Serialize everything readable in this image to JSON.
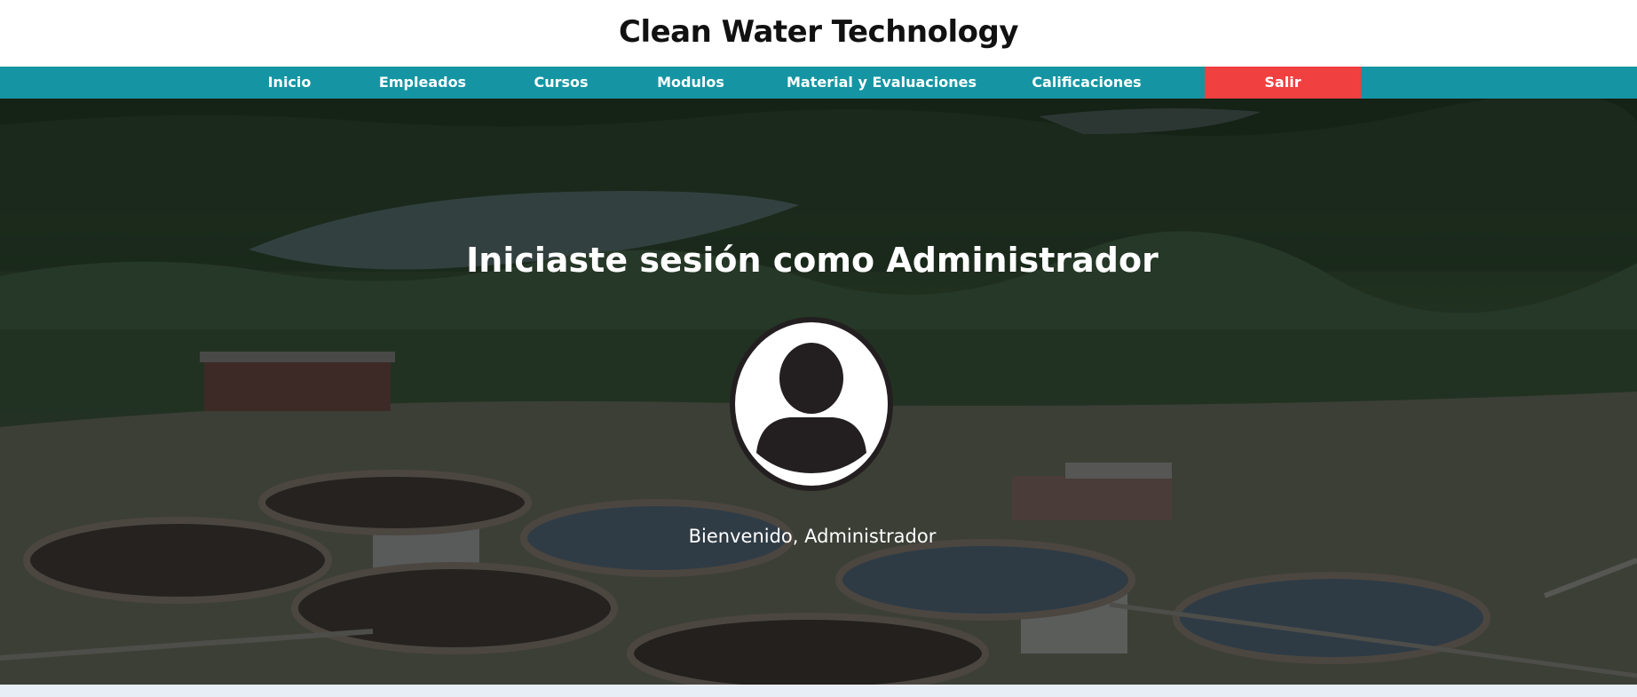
{
  "header": {
    "title": "Clean Water Technology"
  },
  "nav": {
    "items": [
      {
        "label": "Inicio"
      },
      {
        "label": "Empleados"
      },
      {
        "label": "Cursos"
      },
      {
        "label": "Modulos"
      },
      {
        "label": "Material y Evaluaciones"
      },
      {
        "label": "Calificaciones"
      }
    ],
    "logout_label": "Salir",
    "color": "#1595a3",
    "logout_color": "#f04040"
  },
  "hero": {
    "heading": "Iniciaste sesión como Administrador",
    "avatar_icon": "user-avatar-icon",
    "welcome": "Bienvenido, Administrador"
  }
}
